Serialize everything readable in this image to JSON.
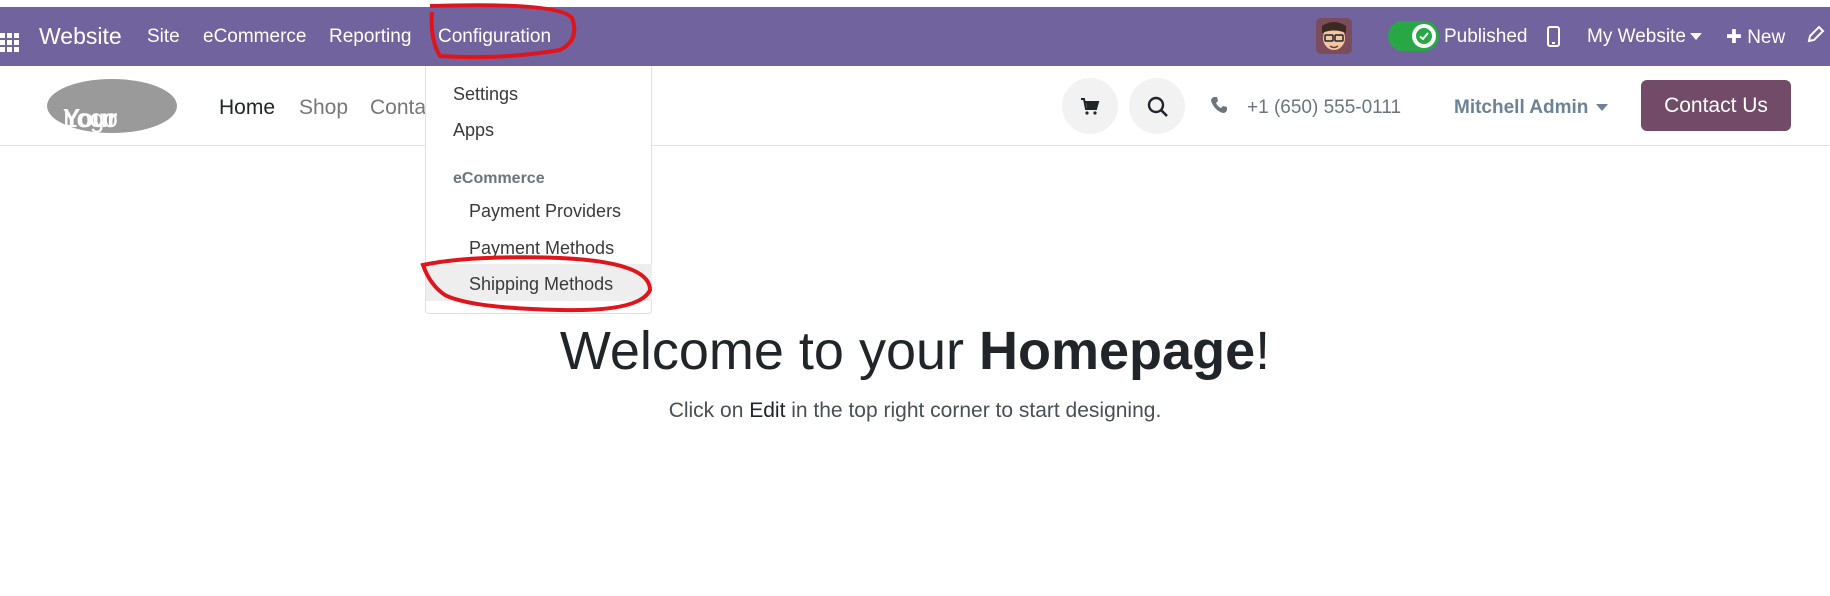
{
  "topbar": {
    "brand": "Website",
    "menus": [
      "Site",
      "eCommerce",
      "Reporting",
      "Configuration"
    ],
    "published_label": "Published",
    "published_on": true,
    "my_website_label": "My Website",
    "new_label": "New",
    "bar_color": "#71639e"
  },
  "site_header": {
    "logo": {
      "bold": "Your",
      "light": "Logo"
    },
    "nav": [
      "Home",
      "Shop",
      "Conta"
    ],
    "phone": "+1 (650) 555-0111",
    "user": "Mitchell Admin",
    "contact_button": "Contact Us",
    "contact_color": "#714b67"
  },
  "dropdown": {
    "items": [
      "Settings",
      "Apps"
    ],
    "section_header": "eCommerce",
    "section_items": [
      "Payment Providers",
      "Payment Methods",
      "Shipping Methods"
    ],
    "highlighted_item": "Shipping Methods"
  },
  "hero": {
    "title_prefix": "Welcome to your ",
    "title_bold": "Homepage",
    "title_suffix": "!",
    "subtitle_prefix": "Click on ",
    "subtitle_edit": "Edit",
    "subtitle_suffix": " in the top right corner to start designing."
  },
  "icons": [
    "apps-grid-icon",
    "avatar",
    "check-icon",
    "mobile-icon",
    "plus-icon",
    "pencil-icon",
    "cart-icon",
    "search-icon",
    "phone-icon"
  ],
  "annotation_color": "#e0151b"
}
